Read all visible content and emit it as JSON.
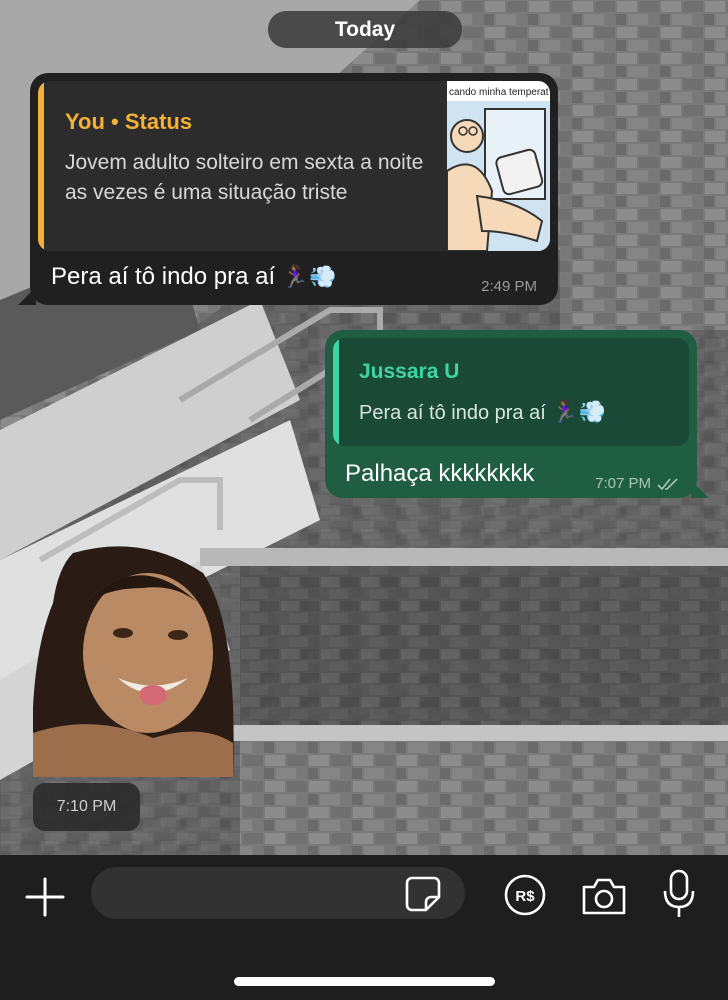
{
  "date_pill": "Today",
  "messages": {
    "incoming": {
      "quote_author": "You • Status",
      "quote_text": "Jovem adulto solteiro em sexta a noite as vezes é uma situação triste",
      "thumb_caption": "cando minha temperat",
      "text": "Pera aí tô indo pra aí",
      "text_emoji": "🏃🏾‍♀️💨",
      "time": "2:49 PM"
    },
    "outgoing": {
      "quote_author": "Jussara U",
      "quote_text": "Pera aí tô indo pra aí",
      "quote_emoji": "🏃🏾‍♀️💨",
      "text": "Palhaça kkkkkkkk",
      "time": "7:07 PM",
      "status_icon": "double-check-icon"
    },
    "sticker": {
      "time": "7:10 PM"
    }
  },
  "input_bar": {
    "placeholder": "",
    "icons": [
      "plus-icon",
      "sticker-icon",
      "pix-payment-icon",
      "camera-icon",
      "microphone-icon"
    ]
  },
  "colors": {
    "incoming_bubble": "#202020",
    "outgoing_bubble": "#1f5e43",
    "status_accent": "#f3b237",
    "contact_accent": "#3fd4a4"
  }
}
